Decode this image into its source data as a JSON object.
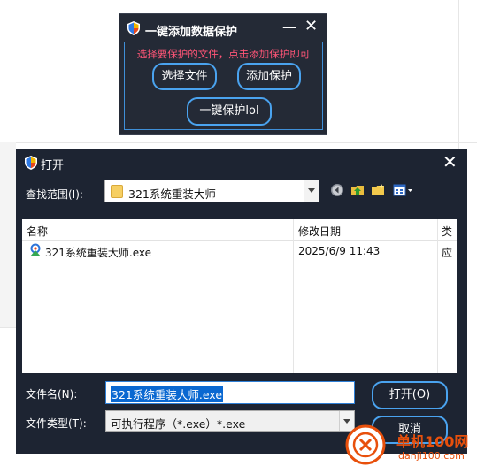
{
  "tool_window": {
    "title": "一键添加数据保护",
    "minimize": "—",
    "close": "✕",
    "hint": "选择要保护的文件，点击添加保护即可",
    "btn_select": "选择文件",
    "btn_add": "添加保护",
    "btn_one_key": "一键保护lol"
  },
  "dialog": {
    "title": "打开",
    "close": "✕",
    "look_in_label": "查找范围(I):",
    "look_in_value": "321系统重装大师",
    "columns": [
      "名称",
      "修改日期",
      "类"
    ],
    "files": [
      {
        "name": "321系统重装大师.exe",
        "date": "2025/6/9 11:43",
        "type": "应"
      }
    ],
    "filename_label": "文件名(N):",
    "filename_value": "321系统重装大师.exe",
    "filetype_label": "文件类型(T):",
    "filetype_value": "可执行程序（*.exe）*.exe",
    "open_button": "打开(O)",
    "cancel_button": "取消"
  },
  "watermark": {
    "name": "单机100网",
    "url": "danji100.com"
  },
  "colors": {
    "dialog_bg": "#1d2432",
    "tool_bg": "#242a36",
    "accent_border": "#4aa3ef",
    "hint_text": "#ff5577",
    "selection": "#0a68d1"
  }
}
